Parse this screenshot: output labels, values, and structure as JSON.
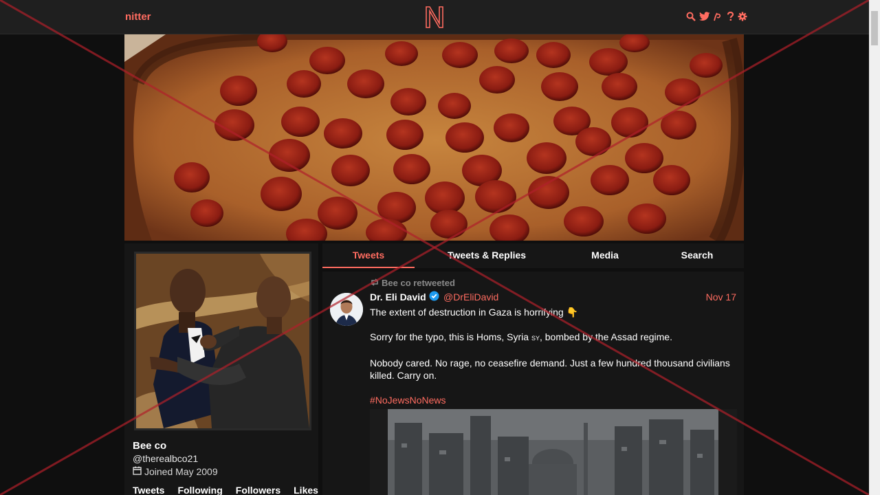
{
  "nav": {
    "brand": "nitter",
    "icons": [
      "search-icon",
      "twitter-icon",
      "rss-icon",
      "help-icon",
      "gear-icon"
    ]
  },
  "profile": {
    "name": "Bee co",
    "handle": "@therealbco21",
    "joined": "Joined May 2009",
    "stats": [
      "Tweets",
      "Following",
      "Followers",
      "Likes"
    ]
  },
  "tabs": {
    "tweets": "Tweets",
    "replies": "Tweets & Replies",
    "media": "Media",
    "search": "Search"
  },
  "tweet": {
    "retweet_label": "Bee co retweeted",
    "author_name": "Dr. Eli David",
    "author_handle": "@DrEliDavid",
    "date": "Nov 17",
    "line1": "The extent of destruction in Gaza is horrifying 👇",
    "line2_prefix": "Sorry for the typo, this is Homs, Syria ",
    "line2_flag": "SY",
    "line2_suffix": ", bombed by the Assad regime.",
    "line3": "Nobody cared. No rage, no ceasefire demand. Just a few hundred thousand civilians killed. Carry on.",
    "hashtag": "#NoJewsNoNews"
  },
  "colors": {
    "accent": "#ff6c60",
    "background": "#0f0f0f",
    "panel": "#161616",
    "overlay_x": "#b0202a"
  }
}
